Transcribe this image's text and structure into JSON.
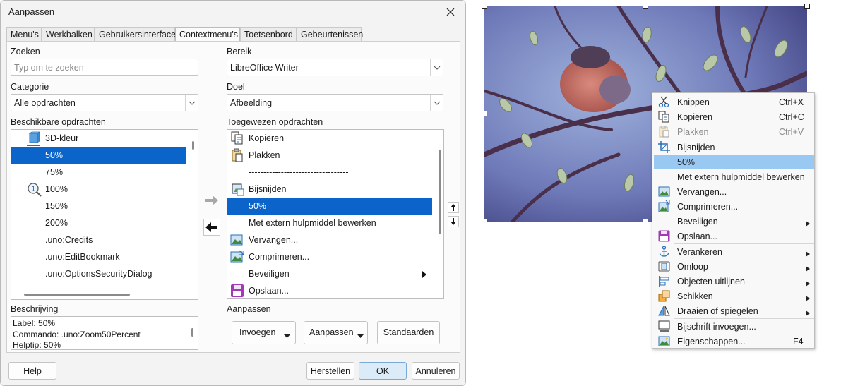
{
  "dialog": {
    "title": "Aanpassen",
    "tabs": [
      "Menu's",
      "Werkbalken",
      "Gebruikersinterface",
      "Contextmenu's",
      "Toetsenbord",
      "Gebeurtenissen"
    ],
    "active_tab": "Contextmenu's",
    "search": {
      "label": "Zoeken",
      "placeholder": "Typ om te zoeken"
    },
    "category": {
      "label": "Categorie",
      "value": "Alle opdrachten"
    },
    "available": {
      "label": "Beschikbare opdrachten",
      "items": [
        "3D-kleur",
        "50%",
        "75%",
        "100%",
        "150%",
        "200%",
        ".uno:Credits",
        ".uno:EditBookmark",
        ".uno:OptionsSecurityDialog"
      ],
      "selected": "50%"
    },
    "description": {
      "label": "Beschrijving",
      "lines": [
        "Label: 50%",
        "Commando: .uno:Zoom50Percent",
        "Helptip: 50%"
      ]
    },
    "scope": {
      "label": "Bereik",
      "value": "LibreOffice Writer"
    },
    "target": {
      "label": "Doel",
      "value": "Afbeelding"
    },
    "assigned": {
      "label": "Toegewezen opdrachten",
      "items": [
        "Kopiëren",
        "Plakken",
        "----------------------------------",
        "Bijsnijden",
        "50%",
        "Met extern hulpmiddel bewerken",
        "Vervangen...",
        "Comprimeren...",
        "Beveiligen",
        "Opslaan..."
      ],
      "selected": "50%"
    },
    "customize_label": "Aanpassen",
    "buttons": {
      "insert": "Invoegen",
      "modify": "Aanpassen",
      "defaults": "Standaarden",
      "help": "Help",
      "reset": "Herstellen",
      "ok": "OK",
      "cancel": "Annuleren"
    }
  },
  "context_menu": {
    "items": [
      {
        "label": "Knippen",
        "shortcut": "Ctrl+X",
        "icon": "scissors-icon"
      },
      {
        "label": "Kopiëren",
        "shortcut": "Ctrl+C",
        "icon": "copy-icon"
      },
      {
        "label": "Plakken",
        "shortcut": "Ctrl+V",
        "icon": "paste-icon",
        "disabled": true
      },
      {
        "label": "Bijsnijden",
        "icon": "crop-icon"
      },
      {
        "label": "50%",
        "highlighted": true
      },
      {
        "label": "Met extern hulpmiddel bewerken"
      },
      {
        "label": "Vervangen...",
        "icon": "replace-image-icon"
      },
      {
        "label": "Comprimeren...",
        "icon": "compress-image-icon"
      },
      {
        "label": "Beveiligen",
        "submenu": true
      },
      {
        "label": "Opslaan...",
        "icon": "save-icon"
      },
      {
        "label": "Verankeren",
        "icon": "anchor-icon",
        "submenu": true
      },
      {
        "label": "Omloop",
        "icon": "wrap-icon",
        "submenu": true
      },
      {
        "label": "Objecten uitlijnen",
        "icon": "align-icon",
        "submenu": true
      },
      {
        "label": "Schikken",
        "icon": "arrange-icon",
        "submenu": true
      },
      {
        "label": "Draaien of spiegelen",
        "icon": "flip-icon",
        "submenu": true
      },
      {
        "label": "Bijschrift invoegen...",
        "icon": "caption-icon"
      },
      {
        "label": "Eigenschappen...",
        "shortcut": "F4",
        "icon": "properties-icon"
      }
    ]
  },
  "colors": {
    "selection": "#0b64c9",
    "menu_highlight": "#99c9f2",
    "ok_button": "#dcebf8"
  }
}
